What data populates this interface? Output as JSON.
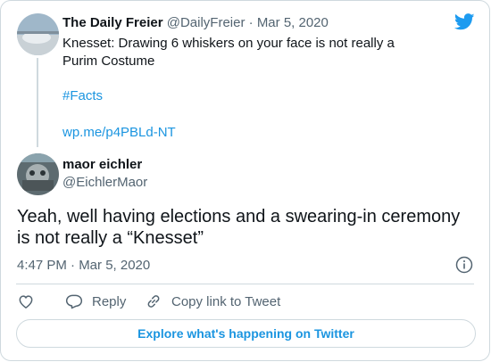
{
  "parent_tweet": {
    "display_name": "The Daily Freier",
    "handle": "@DailyFreier",
    "separator": " · ",
    "date": "Mar 5, 2020",
    "text": "Knesset: Drawing 6 whiskers on your face is not really a Purim Costume",
    "hashtag": "#Facts",
    "link": "wp.me/p4PBLd-NT"
  },
  "tweet": {
    "display_name": "maor eichler",
    "handle": "@EichlerMaor",
    "text": "Yeah, well having elections and a swearing-in ceremony is not really a “Knesset”",
    "timestamp": "4:47 PM · Mar 5, 2020"
  },
  "actions": {
    "like_label": "",
    "reply_label": "Reply",
    "copy_label": "Copy link to Tweet"
  },
  "footer": {
    "explore_label": "Explore what's happening on Twitter"
  },
  "colors": {
    "link": "#1b95e0",
    "muted": "#536471",
    "border": "#cfd9de",
    "brand": "#1d9bf0"
  },
  "icons": [
    "twitter-bird-icon",
    "info-icon",
    "heart-icon",
    "reply-icon",
    "link-icon"
  ]
}
